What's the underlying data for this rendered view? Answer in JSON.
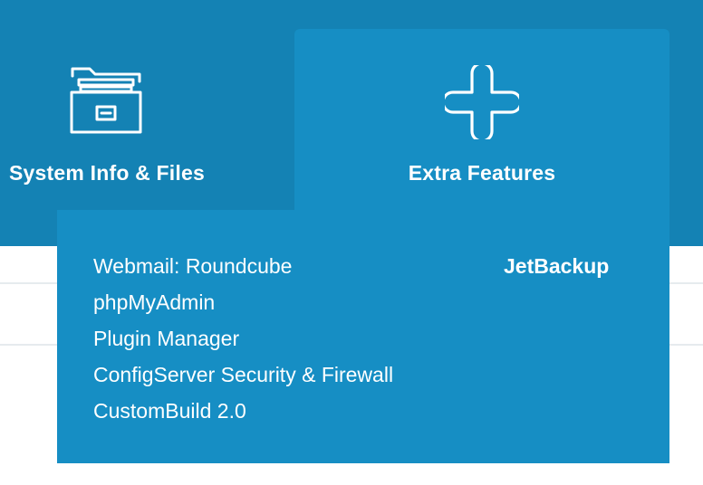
{
  "tabs": [
    {
      "label": "System Info & Files",
      "icon": "folder-icon"
    },
    {
      "label": "Extra Features",
      "icon": "plus-icon",
      "active": true
    }
  ],
  "dropdown": {
    "items": [
      "Webmail: Roundcube",
      "phpMyAdmin",
      "Plugin Manager",
      "ConfigServer Security & Firewall",
      "CustomBuild 2.0"
    ],
    "featured": "JetBackup"
  },
  "colors": {
    "header_bg": "#1482b4",
    "active_tab_bg": "#168ec4",
    "text": "#ffffff"
  }
}
